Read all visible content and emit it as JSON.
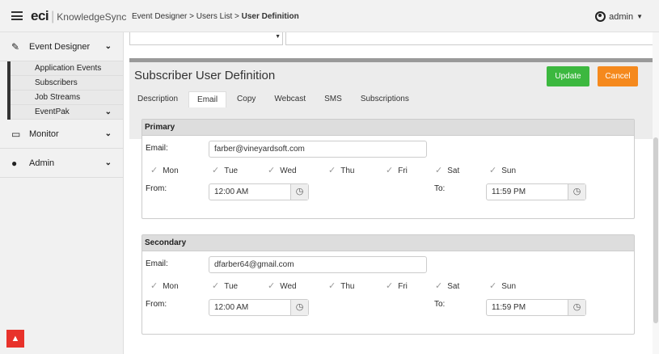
{
  "topbar": {
    "logo_bold": "eci",
    "logo_rest": "KnowledgeSync",
    "breadcrumb_path": "Event Designer > Users List > ",
    "breadcrumb_current": "User Definition",
    "user": "admin"
  },
  "sidebar": {
    "sections": [
      {
        "label": "Event Designer",
        "icon": "edit-icon"
      },
      {
        "label": "Monitor",
        "icon": "monitor-icon"
      },
      {
        "label": "Admin",
        "icon": "user-icon"
      }
    ],
    "event_items": [
      "Application Events",
      "Subscribers",
      "Job Streams",
      "EventPak"
    ]
  },
  "panel": {
    "title": "Subscriber User Definition",
    "update_label": "Update",
    "cancel_label": "Cancel",
    "tabs": [
      "Description",
      "Email",
      "Copy",
      "Webcast",
      "SMS",
      "Subscriptions"
    ],
    "active_tab": "Email"
  },
  "labels": {
    "email": "Email:",
    "from": "From:",
    "to": "To:",
    "days": [
      "Mon",
      "Tue",
      "Wed",
      "Thu",
      "Fri",
      "Sat",
      "Sun"
    ]
  },
  "primary": {
    "heading": "Primary",
    "email": "farber@vineyardsoft.com",
    "from": "12:00 AM",
    "to": "11:59 PM"
  },
  "secondary": {
    "heading": "Secondary",
    "email": "dfarber64@gmail.com",
    "from": "12:00 AM",
    "to": "11:59 PM"
  },
  "colors": {
    "update": "#3cb83f",
    "cancel": "#f5891d",
    "scroll_up": "#e8322b"
  }
}
